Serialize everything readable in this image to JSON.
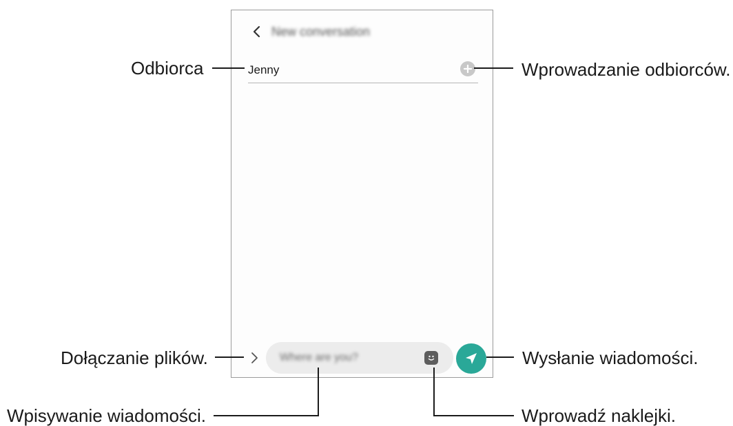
{
  "screen": {
    "title": "New conversation",
    "recipient": "Jenny",
    "message_placeholder": "Where are you?"
  },
  "callouts": {
    "recipient": "Odbiorca",
    "add_recipients": "Wprowadzanie odbiorców.",
    "attach_files": "Dołączanie plików.",
    "send_message": "Wysłanie wiadomości.",
    "type_message": "Wpisywanie wiadomości.",
    "stickers": "Wprowadź naklejki."
  },
  "icons": [
    "chevron-left-icon",
    "plus-icon",
    "chevron-right-icon",
    "sticker-icon",
    "send-icon"
  ],
  "colors": {
    "send_button": "#2aa898",
    "add_button": "#c8c8c8",
    "message_field": "#ececec"
  }
}
